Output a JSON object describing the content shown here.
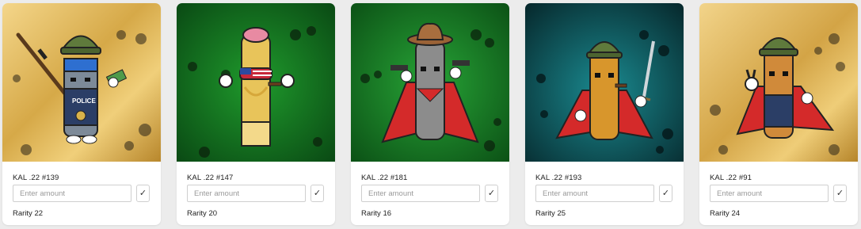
{
  "cards": [
    {
      "name": "KAL .22 #139",
      "placeholder": "Enter amount",
      "confirm": "✓",
      "rarity": "Rarity 22",
      "bg": "gold",
      "hat": "helmet",
      "body_color": "#7d8a98",
      "accessory": "rifle"
    },
    {
      "name": "KAL .22 #147",
      "placeholder": "Enter amount",
      "confirm": "✓",
      "rarity": "Rarity 20",
      "bg": "green",
      "hat": "brain",
      "body_color": "#e8c45a",
      "accessory": "cigar"
    },
    {
      "name": "KAL .22 #181",
      "placeholder": "Enter amount",
      "confirm": "✓",
      "rarity": "Rarity 16",
      "bg": "green",
      "hat": "cowboy",
      "body_color": "#8c8c8c",
      "accessory": "pistols"
    },
    {
      "name": "KAL .22 #193",
      "placeholder": "Enter amount",
      "confirm": "✓",
      "rarity": "Rarity 25",
      "bg": "teal",
      "hat": "helmet",
      "body_color": "#d8962c",
      "accessory": "sword"
    },
    {
      "name": "KAL .22 #91",
      "placeholder": "Enter amount",
      "confirm": "✓",
      "rarity": "Rarity 24",
      "bg": "gold",
      "hat": "helmet",
      "body_color": "#d08a3a",
      "accessory": "peace"
    }
  ]
}
